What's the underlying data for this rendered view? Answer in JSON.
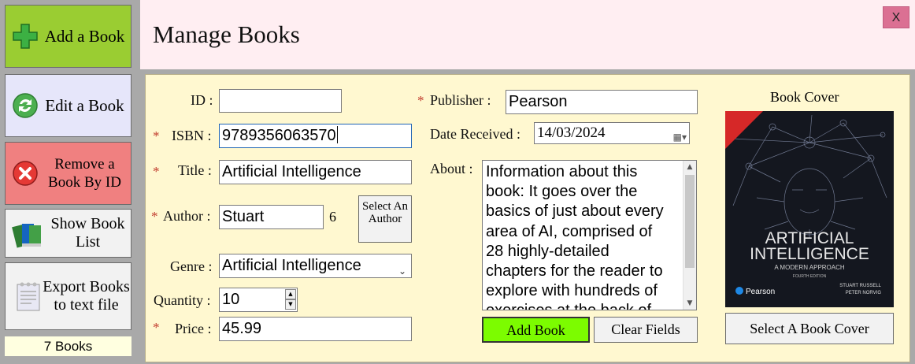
{
  "sidebar": {
    "add_book": "Add a Book",
    "edit_book": "Edit a Book",
    "remove_book": "Remove a Book By ID",
    "show_list": "Show Book List",
    "export": "Export Books to text file",
    "count": "7 Books"
  },
  "header": {
    "title": "Manage Books",
    "close": "X"
  },
  "form": {
    "id_label": "ID :",
    "id_value": "",
    "isbn_label": "ISBN :",
    "isbn_value": "9789356063570",
    "title_label": "Title :",
    "title_value": "Artificial Intelligence",
    "author_label": "Author :",
    "author_value": "Stuart",
    "author_id": "6",
    "select_author": "Select An Author",
    "genre_label": "Genre :",
    "genre_value": "Artificial Intelligence",
    "quantity_label": "Quantity :",
    "quantity_value": "10",
    "price_label": "Price :",
    "price_value": "45.99",
    "publisher_label": "Publisher :",
    "publisher_value": "Pearson",
    "date_label": "Date Received :",
    "date_value": "14/03/2024",
    "about_label": "About :",
    "about_lines": [
      "Information about this",
      "book: It goes over the",
      "basics of just about every",
      "area of AI, comprised of",
      "28 highly-detailed",
      "chapters for the reader to",
      "explore with hundreds of",
      "exercises at the back of"
    ],
    "required_mark": "*"
  },
  "actions": {
    "add": "Add Book",
    "clear": "Clear Fields"
  },
  "cover": {
    "heading": "Book Cover",
    "select": "Select A Book Cover",
    "title_line1": "ARTIFICIAL",
    "title_line2": "INTELLIGENCE",
    "subtitle": "A MODERN APPROACH",
    "edition": "FOURTH EDITION",
    "author1": "STUART RUSSELL",
    "author2": "PETER NORVIG",
    "publisher": "Pearson"
  }
}
